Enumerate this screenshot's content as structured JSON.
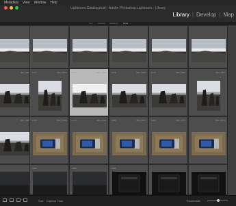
{
  "menubar": {
    "items": [
      "Metadata",
      "View",
      "Window",
      "Help"
    ]
  },
  "window": {
    "title": "Lightroom Catalog.lrcat - Adobe Photoshop Lightroom - Library"
  },
  "modules": {
    "items": [
      {
        "label": "Library",
        "active": true
      },
      {
        "label": "Develop",
        "active": false
      },
      {
        "label": "Map",
        "active": false
      }
    ]
  },
  "filterbar": {
    "items": [
      "Text",
      "Attribute",
      "Metadata",
      "None"
    ]
  },
  "grid": {
    "cells": [
      {
        "num": "",
        "file": "",
        "scene": "lake"
      },
      {
        "num": "",
        "file": "",
        "scene": "lake"
      },
      {
        "num": "",
        "file": "",
        "scene": "lake"
      },
      {
        "num": "",
        "file": "",
        "scene": "lake"
      },
      {
        "num": "",
        "file": "",
        "scene": "lake"
      },
      {
        "num": "",
        "file": "",
        "scene": "lake"
      },
      {
        "num": "",
        "file": "IMG_3062",
        "scene": "stones"
      },
      {
        "num": "1474",
        "file": "IMG_3063",
        "scene": "stones"
      },
      {
        "num": "1475",
        "file": "IMG_3064",
        "scene": "stones"
      },
      {
        "num": "1476",
        "file": "IMG_3065",
        "scene": "stones"
      },
      {
        "num": "1477",
        "file": "IMG_3066",
        "scene": "stones"
      },
      {
        "num": "",
        "file": "IMG_3067",
        "scene": "stones"
      },
      {
        "num": "",
        "file": "IMG_3068",
        "scene": "stones"
      },
      {
        "num": "1478",
        "file": "IMG_3069",
        "scene": "camera"
      },
      {
        "num": "1479",
        "file": "IMG_3070",
        "scene": "camera"
      },
      {
        "num": "1480",
        "file": "IMG_3071",
        "scene": "camera"
      },
      {
        "num": "1481",
        "file": "IMG_3072",
        "scene": "camera"
      },
      {
        "num": "",
        "file": "IMG_3073",
        "scene": "camera"
      },
      {
        "num": "",
        "file": "",
        "scene": "dark"
      },
      {
        "num": "1483",
        "file": "",
        "scene": "dark"
      },
      {
        "num": "1484",
        "file": "",
        "scene": "dark"
      },
      {
        "num": "1485",
        "file": "",
        "scene": "screen"
      },
      {
        "num": "",
        "file": "",
        "scene": "screen"
      },
      {
        "num": "",
        "file": "",
        "scene": "screen"
      }
    ]
  },
  "statusbar": {
    "label": "Capture Time",
    "thumbnails_label": "Thumbnails"
  }
}
